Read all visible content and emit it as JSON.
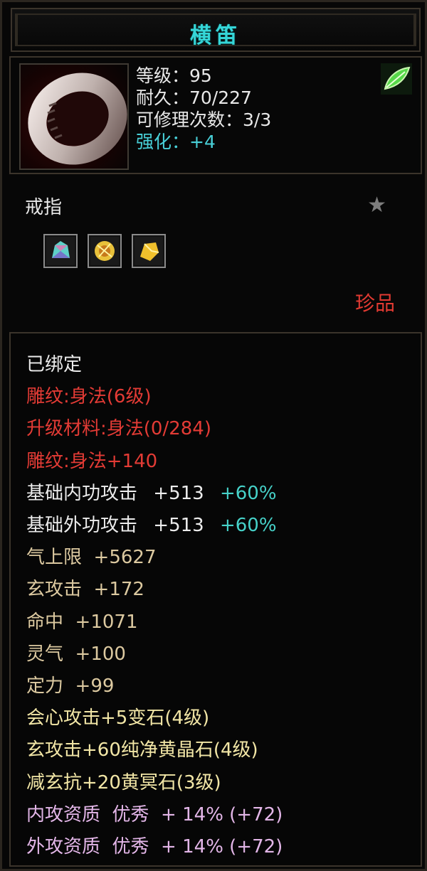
{
  "item": {
    "name": "横笛",
    "stats": [
      {
        "label": "等级：95"
      },
      {
        "label": "耐久：70/227"
      },
      {
        "label": "可修理次数：3/3"
      },
      {
        "label": "强化：+4"
      }
    ],
    "category": "戒指",
    "quality": "珍品",
    "gems": [
      "crystal-gem-icon",
      "yellow-orb-gem-icon",
      "yellow-crystal-gem-icon"
    ]
  },
  "details": {
    "bound": "已绑定",
    "engrave1": "雕纹:身法(6级)",
    "upgrade_material": "升级材料:身法(0/284)",
    "engrave2": "雕纹:身法+140",
    "base_inner_attack": {
      "label": "基础内功攻击",
      "value": "+513",
      "pct": "+60%"
    },
    "base_outer_attack": {
      "label": "基础外功攻击",
      "value": "+513",
      "pct": "+60%"
    },
    "qi_limit": "气上限  +5627",
    "xuan_attack": "玄攻击  +172",
    "hit": "命中  +1071",
    "spirit": "灵气  +100",
    "focus": "定力  +99",
    "gem1": "会心攻击+5变石(4级)",
    "gem2": "玄攻击+60纯净黄晶石(4级)",
    "gem3": "减玄抗+20黄冥石(3级)",
    "inner_aptitude": "内攻资质  优秀  + 14% (+72)",
    "outer_aptitude": "外攻资质  优秀  + 14% (+72)"
  },
  "colors": {
    "title": "#35d6d8",
    "quality": "#e23a32",
    "engrave": "#e33b35",
    "base_attr": "#dcc9a0",
    "gem_attr": "#f2e6a6",
    "aptitude": "#e3b6e8",
    "percent": "#46d1c8"
  }
}
